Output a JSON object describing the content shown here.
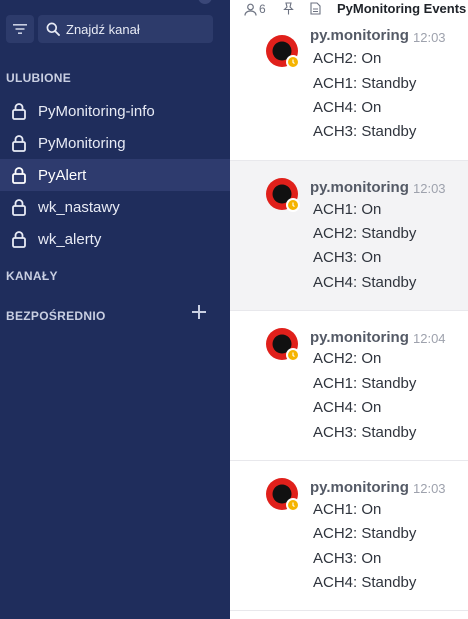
{
  "sidebar": {
    "search_placeholder": "Znajdź kanał",
    "sections": {
      "favorites": "ULUBIONE",
      "channels": "KANAŁY",
      "direct": "BEZPOŚREDNIO"
    },
    "channels": [
      {
        "label": "PyMonitoring-info",
        "active": false
      },
      {
        "label": "PyMonitoring",
        "active": false
      },
      {
        "label": "PyAlert",
        "active": true
      },
      {
        "label": "wk_nastawy",
        "active": false
      },
      {
        "label": "wk_alerty",
        "active": false
      }
    ]
  },
  "header": {
    "members": "6",
    "title": "PyMonitoring Events"
  },
  "messages": [
    {
      "author": "py.monitoring",
      "time": "12:03",
      "lines": [
        "ACH2: On",
        "ACH1: Standby",
        "ACH4: On",
        "ACH3: Standby"
      ]
    },
    {
      "author": "py.monitoring",
      "time": "12:03",
      "lines": [
        "ACH1: On",
        "ACH2: Standby",
        "ACH3: On",
        "ACH4: Standby"
      ]
    },
    {
      "author": "py.monitoring",
      "time": "12:04",
      "lines": [
        "ACH2: On",
        "ACH1: Standby",
        "ACH4: On",
        "ACH3: Standby"
      ]
    },
    {
      "author": "py.monitoring",
      "time": "12:03",
      "lines": [
        "ACH1: On",
        "ACH2: Standby",
        "ACH3: On",
        "ACH4: Standby"
      ]
    }
  ],
  "colors": {
    "sidebar_bg": "#1f2d5c",
    "active_item": "#2e3b6e",
    "avatar_red": "#e0201b",
    "status_badge": "#f5b400"
  }
}
